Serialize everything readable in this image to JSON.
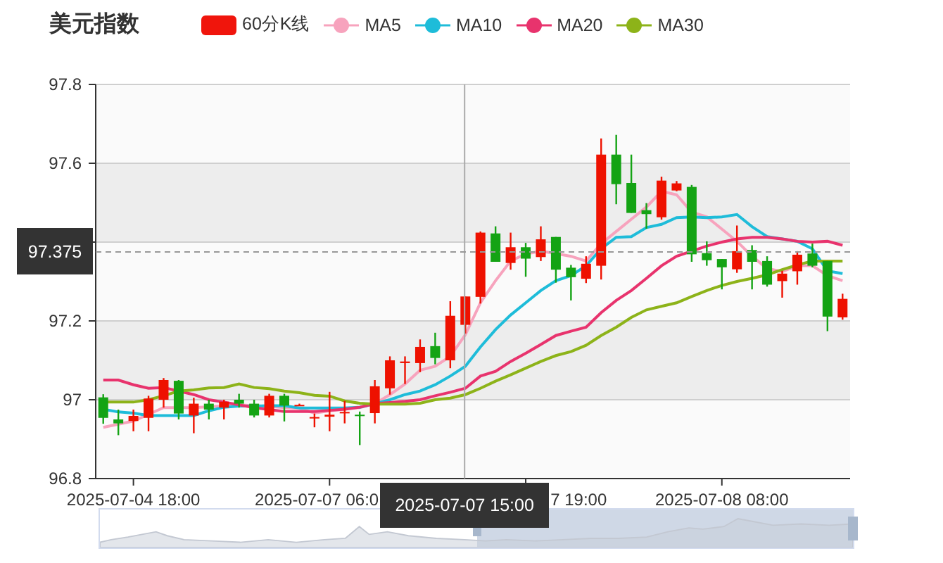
{
  "title": "美元指数",
  "legend": {
    "label": "60分K线",
    "color": "#f0150c"
  },
  "chart_data": {
    "type": "candlestick",
    "ylim": [
      96.8,
      97.8
    ],
    "yticks": [
      97.8,
      97.6,
      97.2,
      97,
      96.8
    ],
    "grid": true,
    "categories": [
      null,
      null,
      "2025-07-04 18:00",
      null,
      null,
      null,
      null,
      null,
      null,
      null,
      null,
      null,
      null,
      null,
      null,
      null,
      null,
      null,
      null,
      null,
      null,
      null,
      null,
      null,
      null,
      null,
      null,
      null,
      null,
      null,
      null,
      null,
      null,
      null,
      null,
      null,
      null,
      null,
      null,
      null,
      null,
      "2025-07-08 08:00",
      null,
      null,
      null,
      null,
      null,
      null,
      null,
      null
    ],
    "ohlc": [
      [
        97.006,
        97.014,
        96.939,
        96.954
      ],
      [
        96.95,
        96.975,
        96.91,
        96.94
      ],
      [
        96.946,
        96.975,
        96.92,
        96.959
      ],
      [
        96.954,
        97.01,
        96.92,
        97.003
      ],
      [
        97.0,
        97.055,
        96.98,
        97.05
      ],
      [
        97.048,
        97.05,
        96.95,
        96.965
      ],
      [
        96.96,
        97.005,
        96.915,
        96.99
      ],
      [
        96.99,
        97.0,
        96.95,
        96.975
      ],
      [
        96.98,
        97.0,
        96.95,
        96.995
      ],
      [
        97.0,
        97.015,
        96.98,
        96.99
      ],
      [
        96.99,
        97.0,
        96.955,
        96.96
      ],
      [
        96.96,
        97.015,
        96.955,
        97.01
      ],
      [
        97.01,
        97.015,
        96.945,
        96.985
      ],
      [
        96.985,
        96.99,
        96.985,
        96.987
      ],
      [
        96.954,
        96.965,
        96.93,
        96.956
      ],
      [
        96.957,
        97.02,
        96.92,
        96.962
      ],
      [
        96.966,
        96.997,
        96.94,
        96.969
      ],
      [
        96.962,
        96.97,
        96.885,
        96.959
      ],
      [
        96.966,
        97.05,
        96.94,
        97.034
      ],
      [
        97.029,
        97.11,
        97.013,
        97.1
      ],
      [
        97.093,
        97.11,
        97.04,
        97.097
      ],
      [
        97.093,
        97.153,
        97.07,
        97.134
      ],
      [
        97.136,
        97.17,
        97.09,
        97.106
      ],
      [
        97.1,
        97.25,
        97.08,
        97.213
      ],
      [
        97.19,
        97.262,
        97.168,
        97.262
      ],
      [
        97.261,
        97.427,
        97.244,
        97.424
      ],
      [
        97.422,
        97.44,
        97.35,
        97.35
      ],
      [
        97.347,
        97.424,
        97.33,
        97.387
      ],
      [
        97.387,
        97.398,
        97.312,
        97.358
      ],
      [
        97.362,
        97.44,
        97.352,
        97.407
      ],
      [
        97.413,
        97.413,
        97.297,
        97.33
      ],
      [
        97.335,
        97.342,
        97.252,
        97.311
      ],
      [
        97.307,
        97.364,
        97.296,
        97.345
      ],
      [
        97.34,
        97.663,
        97.305,
        97.622
      ],
      [
        97.622,
        97.672,
        97.496,
        97.547
      ],
      [
        97.55,
        97.622,
        97.474,
        97.474
      ],
      [
        97.481,
        97.499,
        97.434,
        97.471
      ],
      [
        97.463,
        97.566,
        97.457,
        97.556
      ],
      [
        97.531,
        97.555,
        97.529,
        97.549
      ],
      [
        97.54,
        97.545,
        97.35,
        97.369
      ],
      [
        97.372,
        97.402,
        97.34,
        97.354
      ],
      [
        97.357,
        97.357,
        97.28,
        97.336
      ],
      [
        97.331,
        97.442,
        97.322,
        97.377
      ],
      [
        97.38,
        97.392,
        97.28,
        97.35
      ],
      [
        97.352,
        97.364,
        97.287,
        97.292
      ],
      [
        97.301,
        97.327,
        97.259,
        97.32
      ],
      [
        97.326,
        97.377,
        97.292,
        97.368
      ],
      [
        97.371,
        97.396,
        97.336,
        97.34
      ],
      [
        97.352,
        97.352,
        97.174,
        97.211
      ],
      [
        97.209,
        97.269,
        97.203,
        97.256
      ]
    ],
    "series": [
      {
        "name": "MA5",
        "type": "line",
        "color": "#f7a3bd",
        "values": [
          96.93,
          96.938,
          96.946,
          96.963,
          96.98,
          96.98,
          96.98,
          96.982,
          96.984,
          96.987,
          96.985,
          96.983,
          96.98,
          96.978,
          96.966,
          96.972,
          96.976,
          96.98,
          96.99,
          97.013,
          97.04,
          97.075,
          97.085,
          97.11,
          97.165,
          97.246,
          97.302,
          97.352,
          97.37,
          97.377,
          97.371,
          97.364,
          97.352,
          97.396,
          97.427,
          97.458,
          97.489,
          97.529,
          97.52,
          97.476,
          97.464,
          97.433,
          97.402,
          97.364,
          97.333,
          97.325,
          97.34,
          97.34,
          97.315,
          97.302
        ]
      },
      {
        "name": "MA10",
        "type": "line",
        "color": "#1ebcd9",
        "values": [
          96.976,
          96.969,
          96.966,
          96.96,
          96.96,
          96.96,
          96.96,
          96.972,
          96.981,
          96.984,
          96.984,
          96.985,
          96.985,
          96.979,
          96.979,
          96.979,
          96.979,
          96.981,
          96.99,
          97.0,
          97.013,
          97.022,
          97.038,
          97.06,
          97.085,
          97.134,
          97.178,
          97.215,
          97.246,
          97.277,
          97.302,
          97.315,
          97.34,
          97.383,
          97.412,
          97.414,
          97.437,
          97.445,
          97.462,
          97.464,
          97.462,
          97.464,
          97.47,
          97.439,
          97.414,
          97.408,
          97.402,
          97.383,
          97.327,
          97.32
        ]
      },
      {
        "name": "MA20",
        "type": "line",
        "color": "#e8336d",
        "values": [
          97.05,
          97.05,
          97.038,
          97.029,
          97.031,
          97.022,
          97.013,
          97.0,
          96.994,
          96.987,
          96.98,
          96.975,
          96.97,
          96.97,
          96.97,
          96.973,
          96.976,
          96.981,
          96.99,
          96.993,
          96.996,
          97.0,
          97.01,
          97.019,
          97.029,
          97.06,
          97.072,
          97.097,
          97.118,
          97.14,
          97.163,
          97.174,
          97.184,
          97.221,
          97.252,
          97.277,
          97.308,
          97.34,
          97.364,
          97.377,
          97.39,
          97.4,
          97.408,
          97.412,
          97.412,
          97.408,
          97.402,
          97.4,
          97.402,
          97.392
        ]
      },
      {
        "name": "MA30",
        "type": "line",
        "color": "#8db319",
        "values": [
          96.994,
          96.994,
          96.994,
          97.0,
          97.01,
          97.022,
          97.025,
          97.03,
          97.031,
          97.04,
          97.031,
          97.028,
          97.022,
          97.018,
          97.011,
          97.009,
          96.997,
          96.991,
          96.989,
          96.989,
          96.989,
          96.991,
          97.0,
          97.004,
          97.013,
          97.029,
          97.047,
          97.063,
          97.08,
          97.097,
          97.112,
          97.122,
          97.138,
          97.163,
          97.184,
          97.209,
          97.228,
          97.237,
          97.246,
          97.262,
          97.277,
          97.29,
          97.3,
          97.308,
          97.317,
          97.33,
          97.342,
          97.352,
          97.352,
          97.352
        ]
      }
    ],
    "ref_lines": [
      {
        "axis": "y",
        "value": 97.375,
        "label": "97.375"
      }
    ],
    "bands": [
      {
        "axis": "y",
        "from": 97.4,
        "to": 97.6
      },
      {
        "axis": "y",
        "from": 97.0,
        "to": 97.2
      }
    ]
  },
  "crosshair": {
    "label": "2025-07-07 15:00",
    "level": 0.489
  },
  "covered_axis_labels": [
    "2025-07-07 06:0",
    "7 19:00"
  ],
  "data_zoom": {
    "level": 0.5
  }
}
